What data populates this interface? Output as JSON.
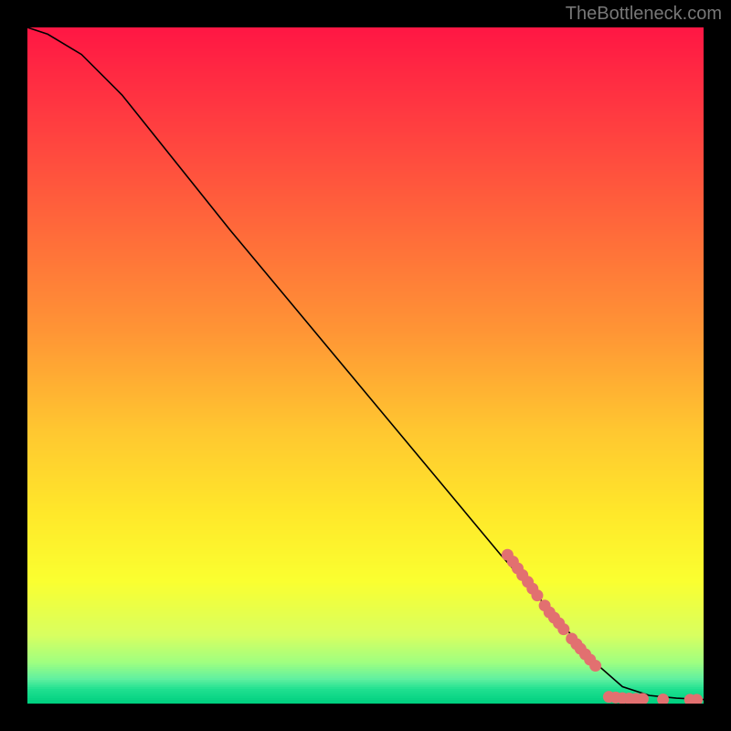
{
  "attribution": "TheBottleneck.com",
  "chart_data": {
    "type": "line",
    "title": "",
    "xlabel": "",
    "ylabel": "",
    "xlim": [
      0,
      100
    ],
    "ylim": [
      0,
      100
    ],
    "curve": [
      {
        "x": 0,
        "y": 100
      },
      {
        "x": 3,
        "y": 99
      },
      {
        "x": 8,
        "y": 96
      },
      {
        "x": 14,
        "y": 90
      },
      {
        "x": 22,
        "y": 80
      },
      {
        "x": 30,
        "y": 70
      },
      {
        "x": 40,
        "y": 58
      },
      {
        "x": 50,
        "y": 46
      },
      {
        "x": 60,
        "y": 34
      },
      {
        "x": 70,
        "y": 22
      },
      {
        "x": 78,
        "y": 13
      },
      {
        "x": 84,
        "y": 6
      },
      {
        "x": 88,
        "y": 2.5
      },
      {
        "x": 92,
        "y": 1.2
      },
      {
        "x": 96,
        "y": 0.8
      },
      {
        "x": 100,
        "y": 0.6
      }
    ],
    "markers": [
      {
        "x": 71,
        "y": 22
      },
      {
        "x": 71.8,
        "y": 21
      },
      {
        "x": 72.5,
        "y": 20
      },
      {
        "x": 73.2,
        "y": 19
      },
      {
        "x": 74,
        "y": 18
      },
      {
        "x": 74.7,
        "y": 17
      },
      {
        "x": 75.4,
        "y": 16
      },
      {
        "x": 76.5,
        "y": 14.5
      },
      {
        "x": 77.2,
        "y": 13.5
      },
      {
        "x": 77.9,
        "y": 12.7
      },
      {
        "x": 78.6,
        "y": 11.9
      },
      {
        "x": 79.3,
        "y": 11
      },
      {
        "x": 80.5,
        "y": 9.6
      },
      {
        "x": 81.2,
        "y": 8.8
      },
      {
        "x": 81.8,
        "y": 8.1
      },
      {
        "x": 82.5,
        "y": 7.3
      },
      {
        "x": 83.2,
        "y": 6.5
      },
      {
        "x": 84,
        "y": 5.6
      },
      {
        "x": 86,
        "y": 1
      },
      {
        "x": 87,
        "y": 0.9
      },
      {
        "x": 88,
        "y": 0.8
      },
      {
        "x": 89,
        "y": 0.75
      },
      {
        "x": 90,
        "y": 0.7
      },
      {
        "x": 91,
        "y": 0.7
      },
      {
        "x": 94,
        "y": 0.6
      },
      {
        "x": 98,
        "y": 0.55
      },
      {
        "x": 99,
        "y": 0.55
      }
    ],
    "marker_color": "#e27070",
    "gradient_stops": [
      {
        "pos": 0.0,
        "color": "#ff1744"
      },
      {
        "pos": 0.15,
        "color": "#ff4040"
      },
      {
        "pos": 0.3,
        "color": "#ff6a3a"
      },
      {
        "pos": 0.45,
        "color": "#ff9535"
      },
      {
        "pos": 0.6,
        "color": "#ffc830"
      },
      {
        "pos": 0.72,
        "color": "#ffe82a"
      },
      {
        "pos": 0.82,
        "color": "#faff30"
      },
      {
        "pos": 0.9,
        "color": "#d8ff60"
      },
      {
        "pos": 0.94,
        "color": "#a0ff80"
      },
      {
        "pos": 0.965,
        "color": "#60f0a0"
      },
      {
        "pos": 0.98,
        "color": "#20e090"
      },
      {
        "pos": 1.0,
        "color": "#00d080"
      }
    ]
  }
}
